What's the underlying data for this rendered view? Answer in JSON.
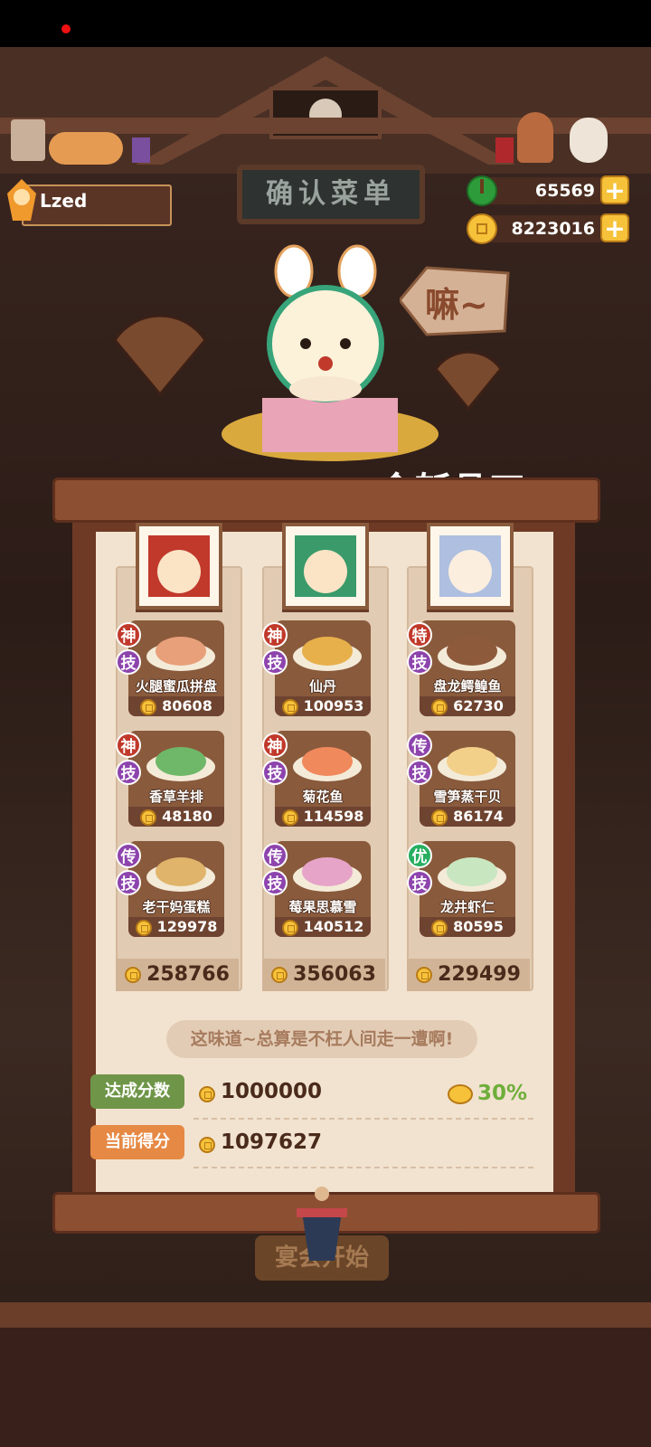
{
  "sign_title": "确认菜单",
  "player": {
    "name": "Lzed"
  },
  "currency": {
    "jade": "65569",
    "coins": "8223016",
    "plus": "+"
  },
  "woo_sign": "嘛~",
  "highlight_dish": "金斩骨刀",
  "columns": [
    {
      "dishes": [
        {
          "name": "火腿蜜瓜拼盘",
          "score": "80608",
          "rank": "神",
          "tag": "技"
        },
        {
          "name": "香草羊排",
          "score": "48180",
          "rank": "神",
          "tag": "技"
        },
        {
          "name": "老干妈蛋糕",
          "score": "129978",
          "rank": "传",
          "tag": "技"
        }
      ],
      "total": "258766"
    },
    {
      "dishes": [
        {
          "name": "仙丹",
          "score": "100953",
          "rank": "神",
          "tag": "技"
        },
        {
          "name": "菊花鱼",
          "score": "114598",
          "rank": "神",
          "tag": "技"
        },
        {
          "name": "莓果思慕雪",
          "score": "140512",
          "rank": "传",
          "tag": "技"
        }
      ],
      "total": "356063"
    },
    {
      "dishes": [
        {
          "name": "盘龙鳄鳇鱼",
          "score": "62730",
          "rank": "特",
          "tag": "技"
        },
        {
          "name": "雪笋蒸干贝",
          "score": "86174",
          "rank": "传",
          "tag": "技"
        },
        {
          "name": "龙井虾仁",
          "score": "80595",
          "rank": "优",
          "tag": "技"
        }
      ],
      "total": "229499"
    }
  ],
  "quote": "这味道~总算是不枉人间走一遭啊!",
  "target": {
    "label": "达成分数",
    "value": "1000000"
  },
  "current": {
    "label": "当前得分",
    "value": "1097627"
  },
  "bonus": "30%",
  "start_button": "宴会开始",
  "colors": {
    "paper": "#f2e3d0",
    "scroll": "#8c4f31",
    "coin": "#f6c23a",
    "target_green": "#6f9648",
    "current_orange": "#e58945"
  }
}
